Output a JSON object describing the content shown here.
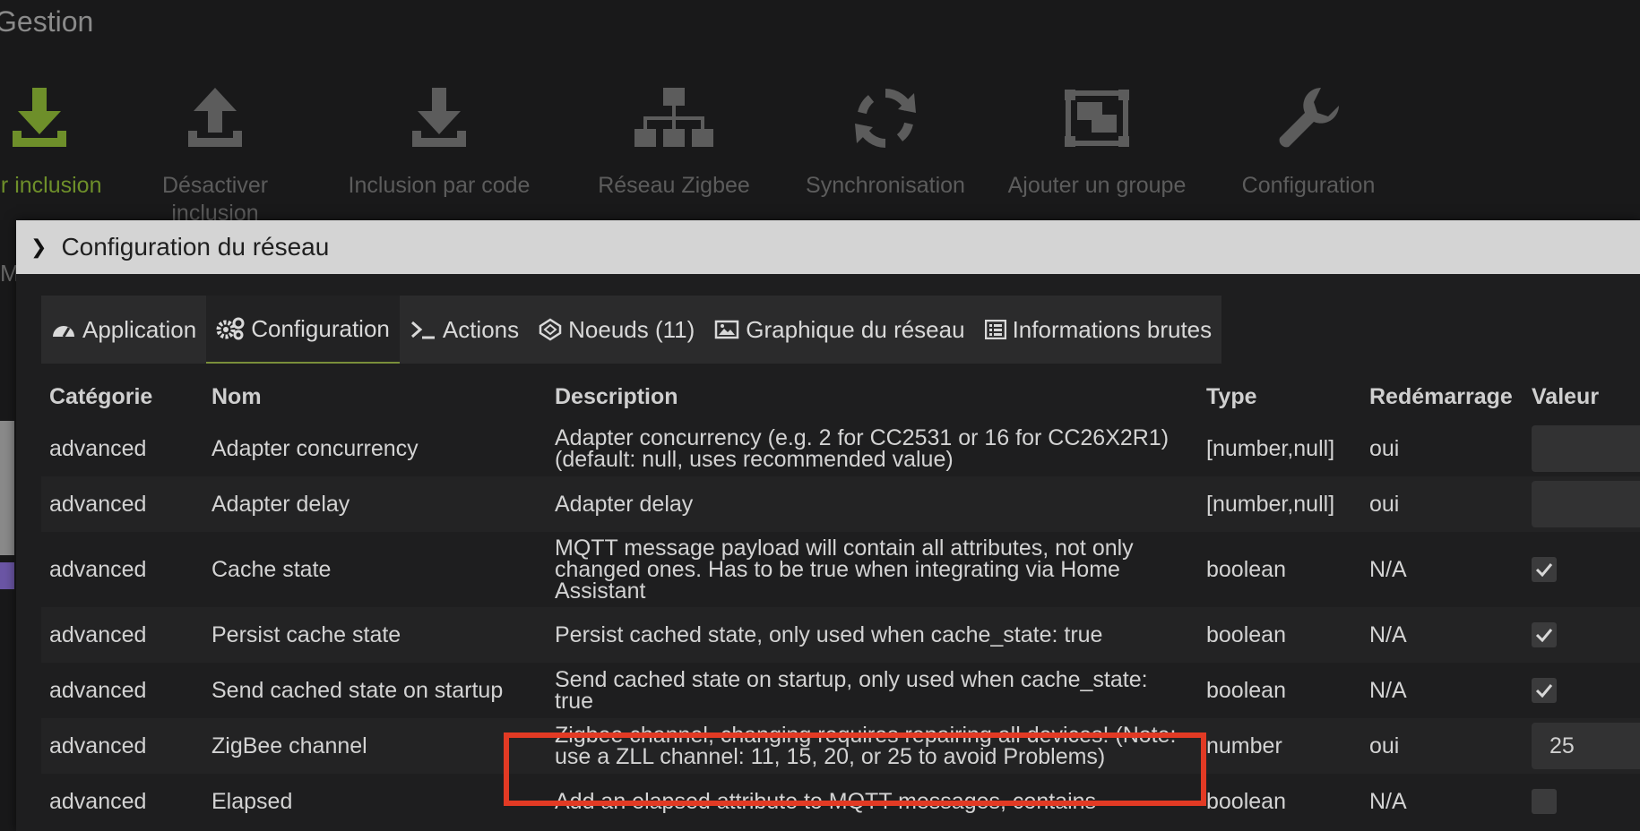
{
  "page": {
    "title": "Gestion"
  },
  "toolbar": {
    "items": [
      {
        "label": "ver inclusion",
        "icon": "download-icon"
      },
      {
        "label": "Désactiver inclusion",
        "icon": "upload-icon"
      },
      {
        "label": "Inclusion par code",
        "icon": "download-icon"
      },
      {
        "label": "Réseau Zigbee",
        "icon": "network-tree-icon"
      },
      {
        "label": "Synchronisation",
        "icon": "sync-icon"
      },
      {
        "label": "Ajouter un groupe",
        "icon": "group-object-icon"
      },
      {
        "label": "Configuration",
        "icon": "wrench-icon"
      }
    ]
  },
  "modal": {
    "title": "Configuration du réseau",
    "tabs": [
      {
        "label": "Application",
        "icon": "dashboard-icon"
      },
      {
        "label": "Configuration",
        "icon": "gears-icon"
      },
      {
        "label": "Actions",
        "icon": "terminal-icon"
      },
      {
        "label": "Noeuds (11)",
        "icon": "codepen-icon"
      },
      {
        "label": "Graphique du réseau",
        "icon": "image-icon"
      },
      {
        "label": "Informations brutes",
        "icon": "list-icon"
      }
    ],
    "active_tab": "Configuration"
  },
  "table": {
    "headers": [
      "Catégorie",
      "Nom",
      "Description",
      "Type",
      "Redémarrage",
      "Valeur"
    ],
    "rows": [
      {
        "category": "advanced",
        "name": "Adapter concurrency",
        "description": "Adapter concurrency (e.g. 2 for CC2531 or 16 for CC26X2R1) (default: null, uses recommended value)",
        "type": "[number,null]",
        "restart": "oui",
        "value": ""
      },
      {
        "category": "advanced",
        "name": "Adapter delay",
        "description": "Adapter delay",
        "type": "[number,null]",
        "restart": "oui",
        "value": ""
      },
      {
        "category": "advanced",
        "name": "Cache state",
        "description": "MQTT message payload will contain all attributes, not only changed ones. Has to be true when integrating via Home Assistant",
        "type": "boolean",
        "restart": "N/A",
        "value": "true"
      },
      {
        "category": "advanced",
        "name": "Persist cache state",
        "description": "Persist cached state, only used when cache_state: true",
        "type": "boolean",
        "restart": "N/A",
        "value": "true"
      },
      {
        "category": "advanced",
        "name": "Send cached state on startup",
        "description": "Send cached state on startup, only used when cache_state: true",
        "type": "boolean",
        "restart": "N/A",
        "value": "true"
      },
      {
        "category": "advanced",
        "name": "ZigBee channel",
        "description": "Zigbee channel, changing requires repairing all devices! (Note: use a ZLL channel: 11, 15, 20, or 25 to avoid Problems)",
        "type": "number",
        "restart": "oui",
        "value": "25"
      },
      {
        "category": "advanced",
        "name": "Elapsed",
        "description": "Add an elapsed attribute to MQTT messages, contains",
        "type": "boolean",
        "restart": "N/A",
        "value": ""
      }
    ]
  },
  "colors": {
    "accent_green": "#6e8f2a",
    "highlight_red": "#e23a24"
  }
}
